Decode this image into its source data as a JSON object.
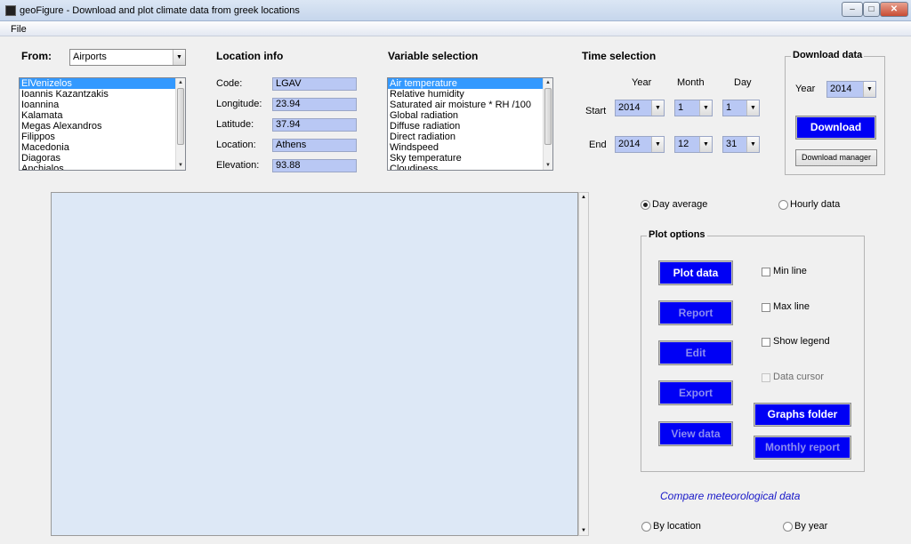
{
  "window": {
    "title": "geoFigure - Download and plot climate data from greek locations"
  },
  "menu": {
    "file": "File"
  },
  "from": {
    "label": "From:",
    "selected": "Airports"
  },
  "locations": [
    "ElVenizelos",
    "Ioannis Kazantzakis",
    "Ioannina",
    "Kalamata",
    "Megas Alexandros",
    "Filippos",
    "Macedonia",
    "Diagoras",
    "Anchialos"
  ],
  "location_info": {
    "title": "Location info",
    "code_label": "Code:",
    "code": "LGAV",
    "longitude_label": "Longitude:",
    "longitude": "23.94",
    "latitude_label": "Latitude:",
    "latitude": "37.94",
    "location_label": "Location:",
    "location": "Athens",
    "elevation_label": "Elevation:",
    "elevation": "93.88"
  },
  "variables": {
    "title": "Variable selection",
    "items": [
      "Air temperature",
      "Relative humidity",
      "Saturated air moisture * RH /100",
      "Global radiation",
      "Diffuse radiation",
      "Direct radiation",
      "Windspeed",
      "Sky temperature",
      "Cloudiness"
    ]
  },
  "time": {
    "title": "Time selection",
    "year_col": "Year",
    "month_col": "Month",
    "day_col": "Day",
    "start_label": "Start",
    "end_label": "End",
    "start": {
      "year": "2014",
      "month": "1",
      "day": "1"
    },
    "end": {
      "year": "2014",
      "month": "12",
      "day": "31"
    }
  },
  "download": {
    "title": "Download data",
    "year_label": "Year",
    "year": "2014",
    "button": "Download",
    "manager": "Download manager"
  },
  "averaging": {
    "day_average": "Day average",
    "hourly": "Hourly data",
    "selected": "day_average"
  },
  "plot_options": {
    "title": "Plot options",
    "plot_data": "Plot data",
    "report": "Report",
    "edit": "Edit",
    "export": "Export",
    "view_data": "View data",
    "min_line": "Min line",
    "max_line": "Max line",
    "show_legend": "Show legend",
    "data_cursor": "Data cursor",
    "graphs_folder": "Graphs folder",
    "monthly_report": "Monthly report"
  },
  "compare": {
    "title": "Compare meteorological data",
    "by_location": "By location",
    "by_year": "By year"
  },
  "colors": {
    "button_blue": "#0000f5",
    "plot_background": "#dde8f6",
    "field_blue": "#b9c8f4",
    "selection": "#3399ff"
  }
}
